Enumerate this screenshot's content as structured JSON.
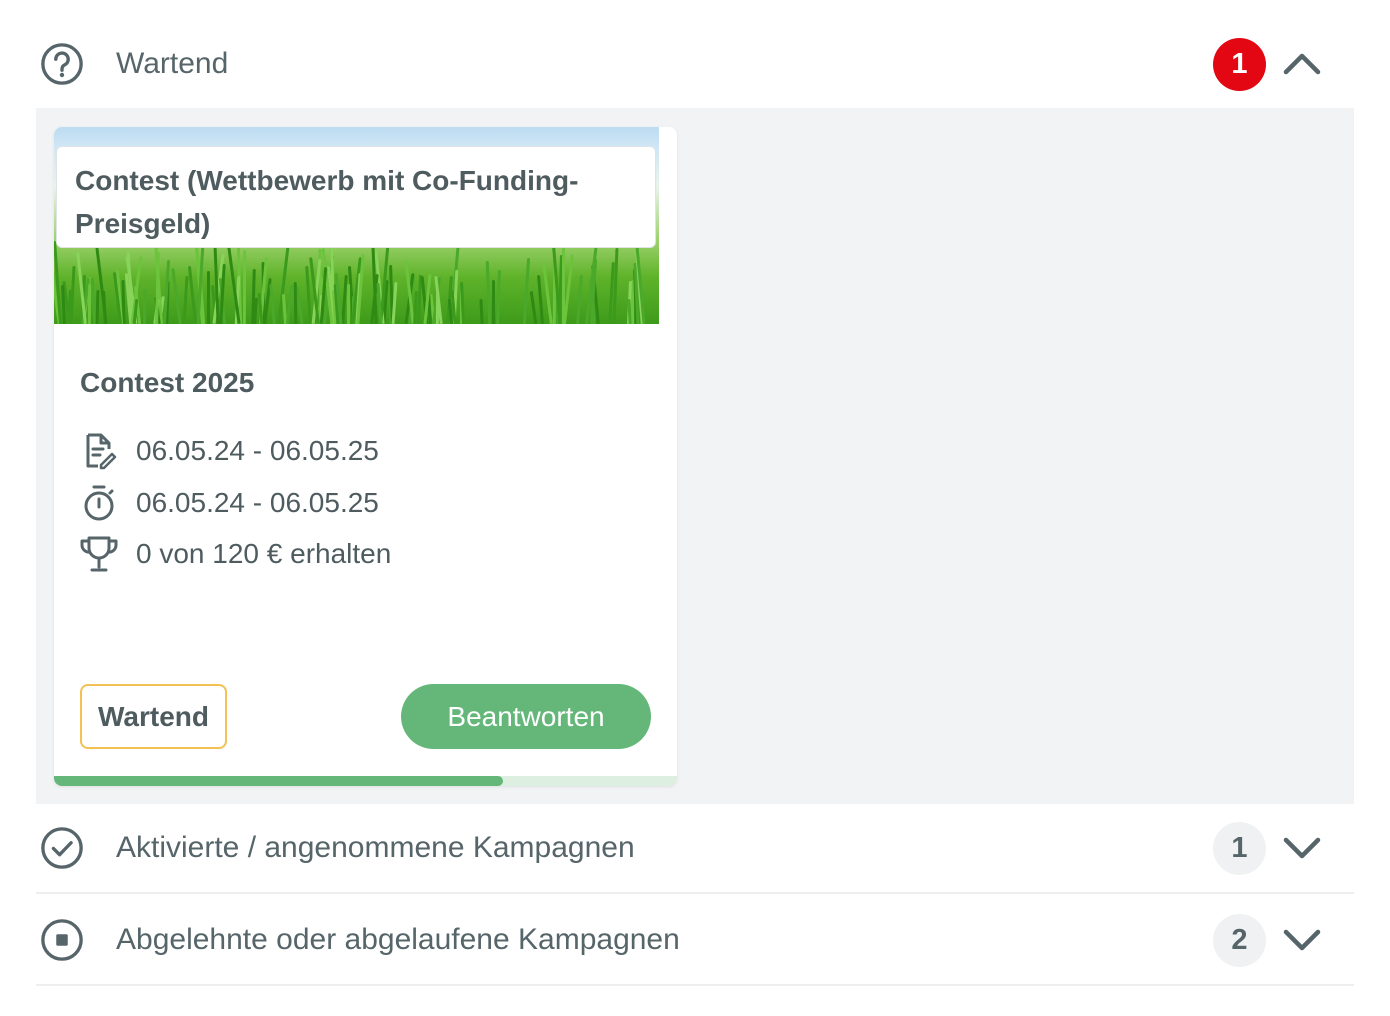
{
  "sections": {
    "waiting": {
      "title": "Wartend",
      "count": "1",
      "icon": "question-circle-icon",
      "expanded": true
    },
    "active": {
      "title": "Aktivierte / angenommene Kampagnen",
      "count": "1",
      "icon": "check-circle-icon",
      "expanded": false
    },
    "declined": {
      "title": "Abgelehnte oder abgelaufene Kampagnen",
      "count": "2",
      "icon": "stop-circle-icon",
      "expanded": false
    }
  },
  "card": {
    "type_title": "Contest (Wettbewerb mit Co-Funding-Preisgeld)",
    "name": "Contest 2025",
    "application_period": "06.05.24 - 06.05.25",
    "run_period": "06.05.24 - 06.05.25",
    "prize_status": "0 von 120 € erhalten",
    "status_label": "Wartend",
    "action_label": "Beantworten",
    "progress": 0.72
  },
  "colors": {
    "accent_green": "#64b779",
    "alert_red": "#e30613",
    "status_border": "#f3c154",
    "panel_bg": "#f2f3f4"
  }
}
